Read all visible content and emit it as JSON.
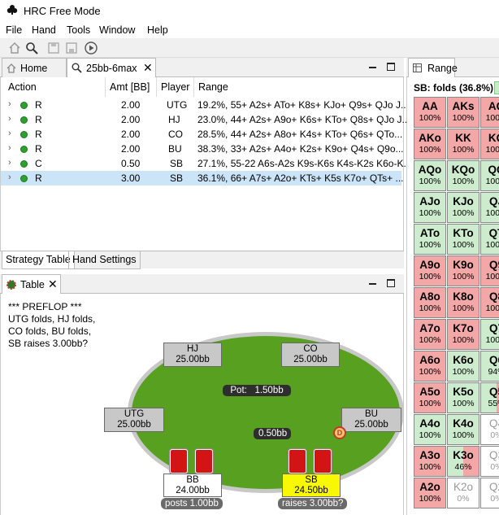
{
  "window": {
    "title": "HRC Free Mode"
  },
  "menu": [
    "File",
    "Hand",
    "Tools",
    "Window",
    "Help"
  ],
  "toolbar_icons": [
    "home-icon",
    "search-icon",
    "save-icon",
    "save-all-icon",
    "play-icon"
  ],
  "left_tabs": [
    {
      "label": "Home"
    },
    {
      "label": "25bb-6max"
    }
  ],
  "strategy": {
    "headers": {
      "action": "Action",
      "amt": "Amt [BB]",
      "player": "Player",
      "range": "Range"
    },
    "rows": [
      {
        "action": "R",
        "amt": "2.00",
        "player": "UTG",
        "range": "19.2%, 55+ A2s+ ATo+ K8s+ KJo+ Q9s+ QJo J..."
      },
      {
        "action": "R",
        "amt": "2.00",
        "player": "HJ",
        "range": "23.0%, 44+ A2s+ A9o+ K6s+ KTo+ Q8s+ QJo J..."
      },
      {
        "action": "R",
        "amt": "2.00",
        "player": "CO",
        "range": "28.5%, 44+ A2s+ A8o+ K4s+ KTo+ Q6s+ QTo..."
      },
      {
        "action": "R",
        "amt": "2.00",
        "player": "BU",
        "range": "38.3%, 33+ A2s+ A4o+ K2s+ K9o+ Q4s+ Q9o..."
      },
      {
        "action": "C",
        "amt": "0.50",
        "player": "SB",
        "range": "27.1%, 55-22 A6s-A2s K9s-K6s K4s-K2s K6o-K..."
      },
      {
        "action": "R",
        "amt": "3.00",
        "player": "SB",
        "range": "36.1%, 66+ A7s+ A2o+ KTs+ K5s K7o+ QTs+ ..."
      }
    ]
  },
  "bottom_tabs": [
    {
      "label": "Strategy Table"
    },
    {
      "label": "Hand Settings"
    }
  ],
  "table_window": {
    "tab_label": "Table"
  },
  "game": {
    "log": "*** PREFLOP ***\nUTG folds, HJ folds,\nCO folds, BU folds,\nSB raises 3.00bb?",
    "pot_label": "Pot:",
    "pot_value": "1.50bb",
    "bet_value": "0.50bb",
    "seats": {
      "hj": {
        "name": "HJ",
        "stack": "25.00bb"
      },
      "co": {
        "name": "CO",
        "stack": "25.00bb"
      },
      "utg": {
        "name": "UTG",
        "stack": "25.00bb"
      },
      "bu": {
        "name": "BU",
        "stack": "25.00bb"
      },
      "bb": {
        "name": "BB",
        "stack": "24.00bb",
        "tag": "posts 1.00bb"
      },
      "sb": {
        "name": "SB",
        "stack": "24.50bb",
        "tag": "raises 3.00bb?"
      }
    },
    "dealer_button": "D"
  },
  "range": {
    "tab_label": "Range",
    "header": "SB: folds (36.8%)",
    "colors": {
      "fold": "#f3a7a7",
      "raise": "#cdeccd"
    },
    "grid": [
      [
        {
          "h": "AA",
          "p": "100%",
          "c": "pink"
        },
        {
          "h": "AKs",
          "p": "100%",
          "c": "pink"
        },
        {
          "h": "AQ",
          "p": "100%",
          "c": "pink"
        }
      ],
      [
        {
          "h": "AKo",
          "p": "100%",
          "c": "pink"
        },
        {
          "h": "KK",
          "p": "100%",
          "c": "pink"
        },
        {
          "h": "KQ",
          "p": "100%",
          "c": "pink"
        }
      ],
      [
        {
          "h": "AQo",
          "p": "100%",
          "c": "green"
        },
        {
          "h": "KQo",
          "p": "100%",
          "c": "green"
        },
        {
          "h": "QQ",
          "p": "100%",
          "c": "green"
        }
      ],
      [
        {
          "h": "AJo",
          "p": "100%",
          "c": "green"
        },
        {
          "h": "KJo",
          "p": "100%",
          "c": "green"
        },
        {
          "h": "QJ",
          "p": "100%",
          "c": "green"
        }
      ],
      [
        {
          "h": "ATo",
          "p": "100%",
          "c": "green"
        },
        {
          "h": "KTo",
          "p": "100%",
          "c": "green"
        },
        {
          "h": "QT",
          "p": "100%",
          "c": "green"
        }
      ],
      [
        {
          "h": "A9o",
          "p": "100%",
          "c": "pink"
        },
        {
          "h": "K9o",
          "p": "100%",
          "c": "pink"
        },
        {
          "h": "Q9",
          "p": "100%",
          "c": "pink"
        }
      ],
      [
        {
          "h": "A8o",
          "p": "100%",
          "c": "pink"
        },
        {
          "h": "K8o",
          "p": "100%",
          "c": "pink"
        },
        {
          "h": "Q8",
          "p": "100%",
          "c": "pink"
        }
      ],
      [
        {
          "h": "A7o",
          "p": "100%",
          "c": "pink"
        },
        {
          "h": "K7o",
          "p": "100%",
          "c": "pink"
        },
        {
          "h": "Q7",
          "p": "100%",
          "c": "green"
        }
      ],
      [
        {
          "h": "A6o",
          "p": "100%",
          "c": "pink"
        },
        {
          "h": "K6o",
          "p": "100%",
          "c": "green"
        },
        {
          "h": "Q6",
          "p": "94%",
          "c": "green"
        }
      ],
      [
        {
          "h": "A5o",
          "p": "100%",
          "c": "pink"
        },
        {
          "h": "K5o",
          "p": "100%",
          "c": "green"
        },
        {
          "h": "Q5",
          "p": "55%",
          "c": "half"
        }
      ],
      [
        {
          "h": "A4o",
          "p": "100%",
          "c": "green"
        },
        {
          "h": "K4o",
          "p": "100%",
          "c": "green"
        },
        {
          "h": "Q4",
          "p": "0%",
          "c": "white2"
        }
      ],
      [
        {
          "h": "A3o",
          "p": "100%",
          "c": "pink"
        },
        {
          "h": "K3o",
          "p": "46%",
          "c": "half"
        },
        {
          "h": "Q3",
          "p": "0%",
          "c": "white2"
        }
      ],
      [
        {
          "h": "A2o",
          "p": "100%",
          "c": "pink"
        },
        {
          "h": "K2o",
          "p": "0%",
          "c": "white2"
        },
        {
          "h": "Q2",
          "p": "0%",
          "c": "white2"
        }
      ]
    ]
  }
}
